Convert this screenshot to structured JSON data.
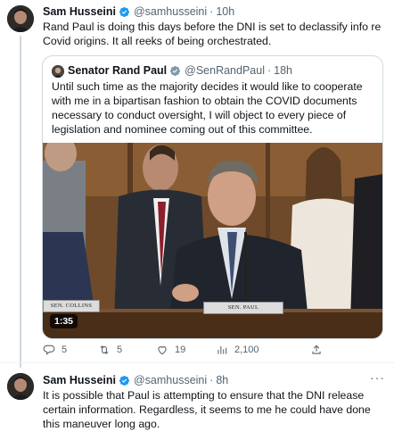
{
  "tweet1": {
    "author_name": "Sam Husseini",
    "handle": "@samhusseini",
    "separator": "·",
    "time": "10h",
    "text": "Rand Paul is doing this days before the DNI is set to declassify info re Covid origins. It all reeks of being orchestrated.",
    "quote": {
      "author_name": "Senator Rand Paul",
      "handle": "@SenRandPaul",
      "separator": "·",
      "time": "18h",
      "text": "Until such time as the majority decides it would like to cooperate with me in a bipartisan fashion to obtain the COVID documents necessary to conduct oversight, I will object to every piece of legislation and nominee coming out of this committee.",
      "media": {
        "duration": "1:35",
        "nameplate_left": "SEN. COLLINS",
        "nameplate_center": "SEN. PAUL"
      }
    },
    "actions": {
      "replies": "5",
      "retweets": "5",
      "likes": "19",
      "views": "2,100"
    }
  },
  "tweet2": {
    "author_name": "Sam Husseini",
    "handle": "@samhusseini",
    "separator": "·",
    "time": "8h",
    "text": "It is possible that Paul is attempting to ensure that the DNI release certain information. Regardless, it seems to me he could have done this maneuver long ago."
  },
  "colors": {
    "verified": "#1d9bf0",
    "secondary_text": "#536471",
    "border": "#cfd9de"
  },
  "icons": [
    "verified-badge-icon",
    "more-icon",
    "reply-icon",
    "retweet-icon",
    "like-icon",
    "views-icon",
    "share-icon",
    "play-duration"
  ]
}
